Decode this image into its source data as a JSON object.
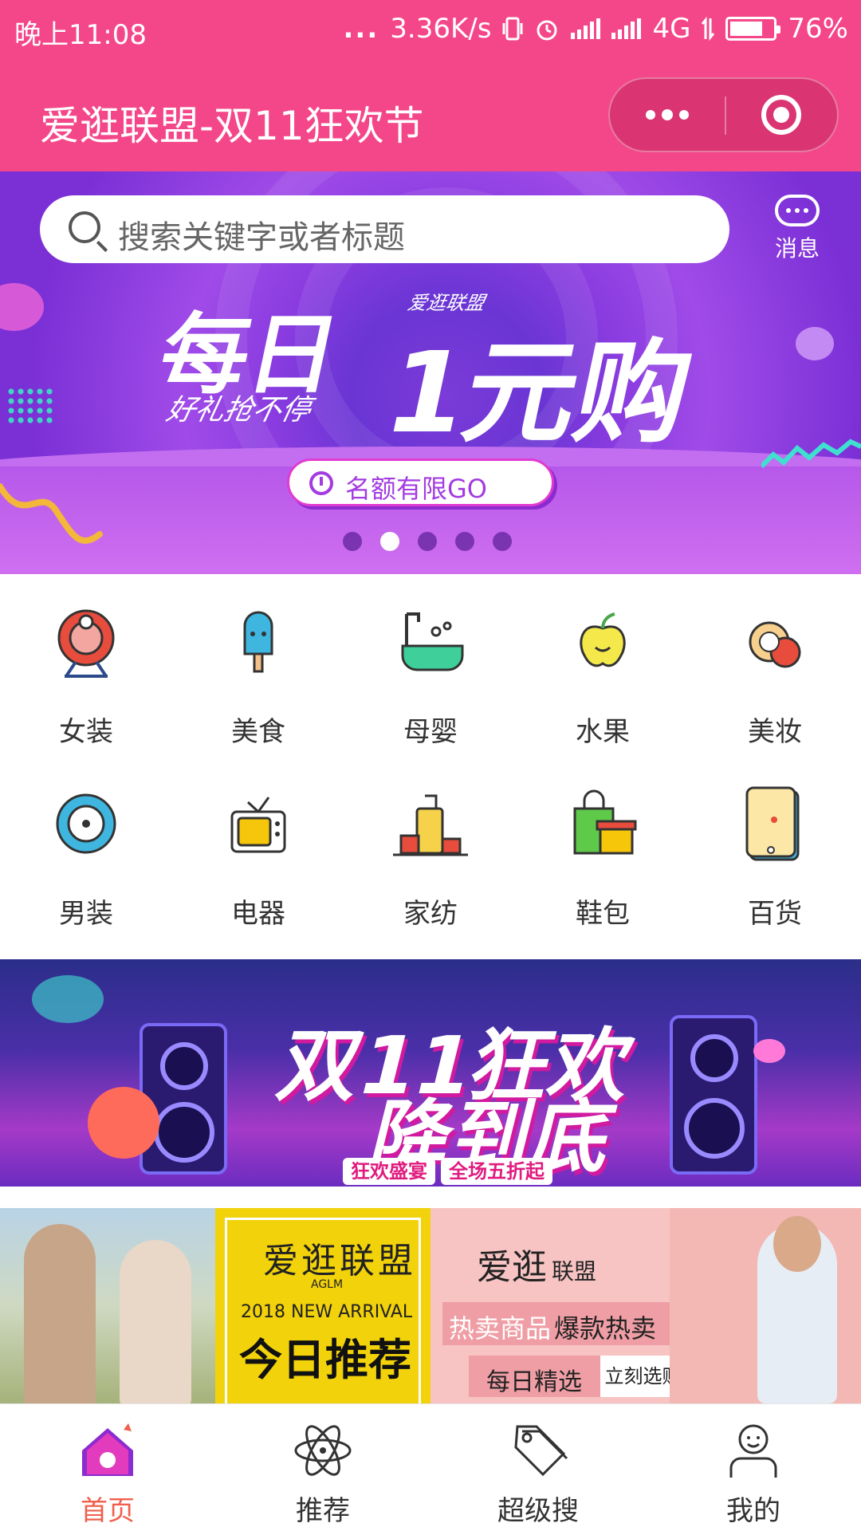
{
  "status_bar": {
    "time": "晚上11:08",
    "dots": "...",
    "speed": "3.36K/s",
    "network": "4G",
    "battery": "76%",
    "battery_level": 0.76
  },
  "nav": {
    "title": "爱逛联盟-双11狂欢节"
  },
  "search": {
    "placeholder": "搜索关键字或者标题"
  },
  "message": {
    "label": "消息"
  },
  "hero": {
    "brand": "爱逛联盟",
    "headline_1": "每日",
    "headline_2": "1元购",
    "subtitle": "好礼抢不停",
    "button_label": "名额有限GO",
    "slide_count": 5,
    "active_slide": 2
  },
  "categories": [
    {
      "label": "女装",
      "icon": "target-icon"
    },
    {
      "label": "美食",
      "icon": "popsicle-icon"
    },
    {
      "label": "母婴",
      "icon": "bathtub-icon"
    },
    {
      "label": "水果",
      "icon": "apple-icon"
    },
    {
      "label": "美妆",
      "icon": "compact-icon"
    },
    {
      "label": "男装",
      "icon": "record-icon"
    },
    {
      "label": "电器",
      "icon": "tv-icon"
    },
    {
      "label": "家纺",
      "icon": "luggage-icon"
    },
    {
      "label": "鞋包",
      "icon": "shopping-bag-icon"
    },
    {
      "label": "百货",
      "icon": "tablet-icon"
    }
  ],
  "festival_banner": {
    "line_1": "双11狂欢",
    "line_2": "降到底",
    "tag_1": "狂欢盛宴",
    "tag_2": "全场五折起"
  },
  "recommend_banner": {
    "brand": "爱逛联盟",
    "brand_abbr": "AGLM",
    "arrival": "2018  NEW ARRIVAL",
    "today": "今日推荐",
    "brand_2": "爱逛",
    "brand_2_suffix": "联盟",
    "hot_1": "热卖商品",
    "hot_2": "爆款热卖",
    "daily": "每日精选",
    "buy": "立刻选购"
  },
  "tabbar": [
    {
      "label": "首页",
      "icon": "home-icon",
      "active": true
    },
    {
      "label": "推荐",
      "icon": "atom-icon",
      "active": false
    },
    {
      "label": "超级搜",
      "icon": "tag-icon",
      "active": false
    },
    {
      "label": "我的",
      "icon": "user-icon",
      "active": false
    }
  ],
  "colors": {
    "brand_pink": "#f4478a",
    "active_tab": "#f0604c",
    "hero_purple": "#8a3ce0"
  }
}
